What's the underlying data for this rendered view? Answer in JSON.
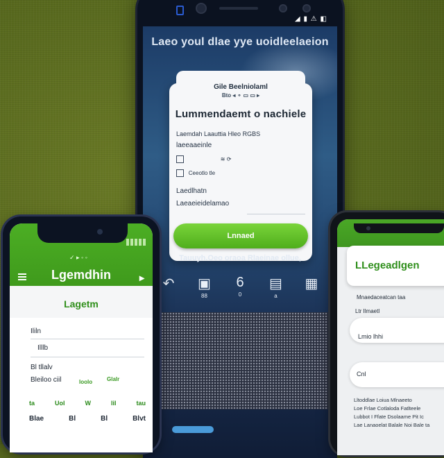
{
  "center_phone": {
    "status": "◢ ▮ ⚠ ◧",
    "headline": "Laeo youl dlae yye uoidleelaeion",
    "card": {
      "tab_label": "Gile Beelniolaml",
      "subtab": "Bto ◂ ⚬ ▭ ▭ ▸",
      "title": "Lummendaemt o nachiele",
      "line1": "Laemdah Laauttia Hleo RGBS",
      "line2": "laeeaaeinle",
      "line3": "Ceeotlo tle",
      "line4": "Laedlhatn",
      "line5": "Laeaeieidelamao",
      "line6": "≋ ⟳",
      "button": "Lnnaed"
    },
    "sub_text": "Tauuyh.Oeo oraoa Rlaeinae ollue,",
    "icons": [
      {
        "name": "refresh-icon",
        "glyph": "↶",
        "label": ""
      },
      {
        "name": "calendar-icon",
        "glyph": "▣",
        "label": "88"
      },
      {
        "name": "number-icon",
        "glyph": "6",
        "label": "0"
      },
      {
        "name": "folder-icon",
        "glyph": "▤",
        "label": "a"
      },
      {
        "name": "document-icon",
        "glyph": "▦",
        "label": ""
      }
    ]
  },
  "left_phone": {
    "status": "✓ ▸ ◦ ◦",
    "title": "Lgemdhin",
    "login_label": "Lagetm",
    "rows": [
      "Ililn",
      "Illlb",
      "Bl tllalv",
      "Bleiloo ciil"
    ],
    "green_tags": [
      "Ioolo",
      "Glalr"
    ],
    "tabs_top": [
      "ta",
      "Uol",
      "W",
      "lil",
      "tau"
    ],
    "tabs_bottom": [
      "Blae",
      "Bl",
      "Bl",
      "Blvt"
    ]
  },
  "right_phone": {
    "title": "LLegeadlgen",
    "line1": "Mnaedaceatcan taa",
    "line2": "Ltr Ilmaetl",
    "pill1": "Lmio lhhi",
    "pill2": "Cnl",
    "small1": "Lltoddlae Loiua Mlnaeeto",
    "small2": "Loe Frlae Cotlaloda Fatlteele",
    "small3": "Lubbot I Ffate Dsolaame Pit Ic",
    "small4": "Lae Lanaoelat Balale Noi Bale ta"
  }
}
